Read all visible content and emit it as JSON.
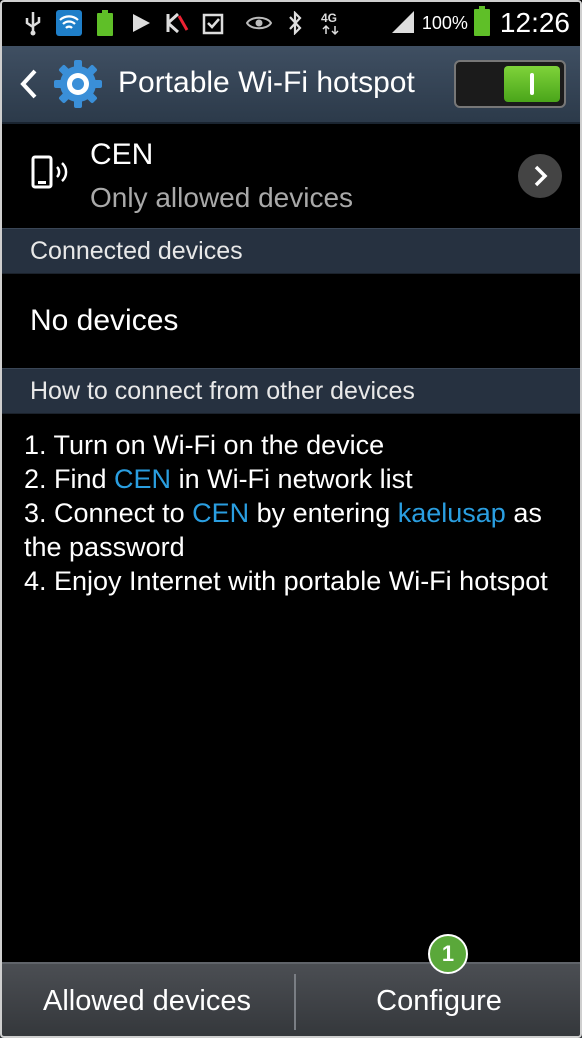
{
  "status_bar": {
    "icons": [
      "usb-icon",
      "wifi-icon",
      "battery-small-icon",
      "play-store-icon",
      "kaspersky-icon",
      "clipboard-icon",
      "eye-icon",
      "bluetooth-icon",
      "4g-icon",
      "signal-icon"
    ],
    "battery_percent": "100%",
    "time": "12:26"
  },
  "action_bar": {
    "title": "Portable Wi-Fi hotspot",
    "toggle_on": true
  },
  "network": {
    "name": "CEN",
    "subtitle": "Only allowed devices"
  },
  "connected_section": {
    "header": "Connected devices",
    "empty_text": "No devices"
  },
  "howto_section": {
    "header": "How to connect from other devices",
    "step1": "1. Turn on Wi-Fi on the device",
    "step2_pre": "2. Find ",
    "step2_ssid": "CEN",
    "step2_post": " in Wi-Fi network list",
    "step3_pre": "3. Connect to ",
    "step3_ssid": "CEN",
    "step3_mid": " by entering ",
    "step3_password": "kaelusap",
    "step3_post": " as the password",
    "step4": "4. Enjoy Internet with portable Wi-Fi hotspot"
  },
  "bottom_bar": {
    "allowed_label": "Allowed devices",
    "configure_label": "Configure"
  },
  "annotation_badge": "1",
  "colors": {
    "accent_link": "#2a9ee0",
    "toggle_on": "#5fbf28",
    "header_bg": "#263140",
    "badge": "#5aa83a"
  }
}
